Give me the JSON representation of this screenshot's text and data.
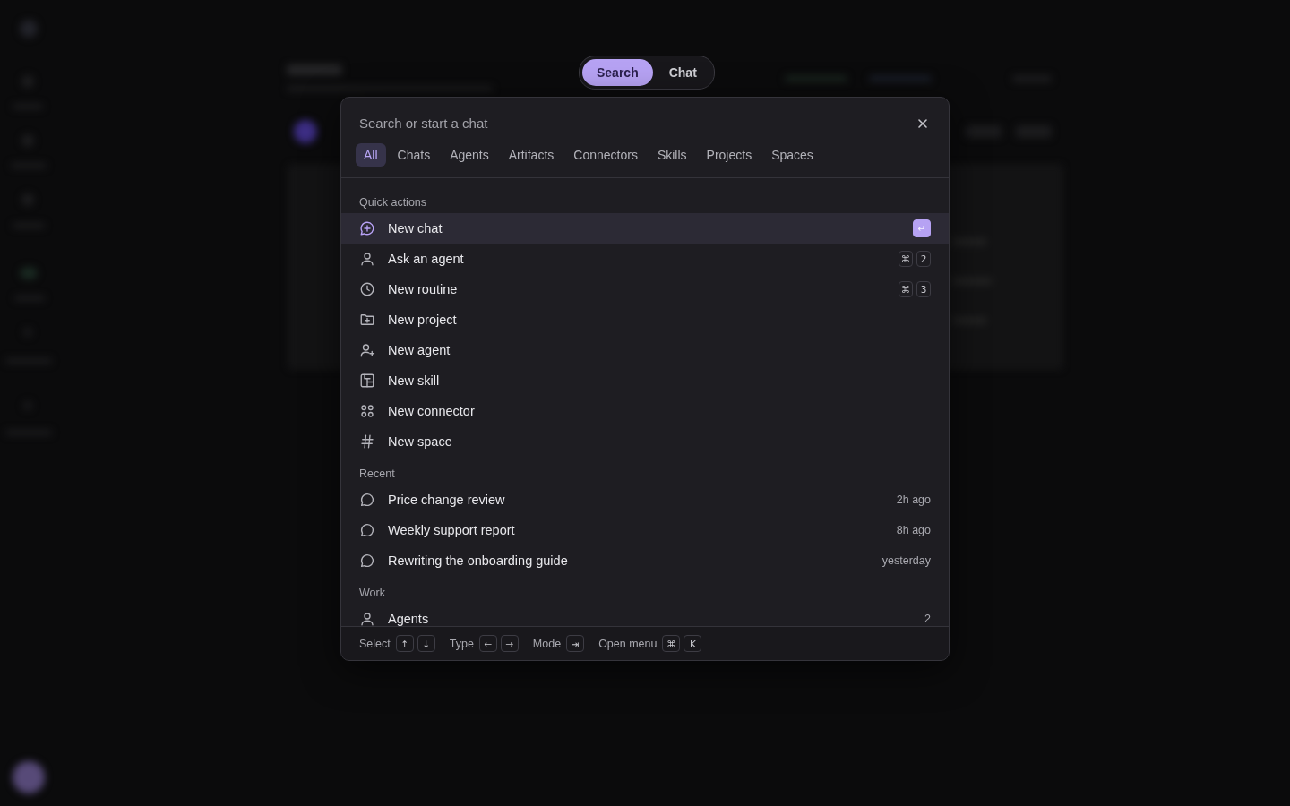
{
  "mode_switch": [
    {
      "label": "Search",
      "selected": true
    },
    {
      "label": "Chat",
      "selected": false
    }
  ],
  "search": {
    "placeholder": "Search or start a chat"
  },
  "filters": [
    {
      "label": "All",
      "selected": true
    },
    {
      "label": "Chats",
      "selected": false
    },
    {
      "label": "Agents",
      "selected": false
    },
    {
      "label": "Artifacts",
      "selected": false
    },
    {
      "label": "Connectors",
      "selected": false
    },
    {
      "label": "Skills",
      "selected": false
    },
    {
      "label": "Projects",
      "selected": false
    },
    {
      "label": "Spaces",
      "selected": false
    }
  ],
  "sections": [
    {
      "title": "Quick actions",
      "items": [
        {
          "label": "New chat",
          "kind": "compose",
          "selected": true,
          "keys": [
            "↵"
          ]
        },
        {
          "label": "Ask an agent",
          "kind": "person",
          "selected": false,
          "keys": [
            "⌘",
            "2"
          ]
        },
        {
          "label": "New routine",
          "kind": "routine",
          "selected": false,
          "keys": [
            "⌘",
            "3"
          ]
        },
        {
          "label": "New project",
          "kind": "project",
          "selected": false
        },
        {
          "label": "New agent",
          "kind": "agent",
          "selected": false
        },
        {
          "label": "New skill",
          "kind": "skill",
          "selected": false
        },
        {
          "label": "New connector",
          "kind": "connector",
          "selected": false
        },
        {
          "label": "New space",
          "kind": "space",
          "selected": false
        }
      ]
    },
    {
      "title": "Recent",
      "items": [
        {
          "label": "Price change review",
          "kind": "conversation",
          "selected": false,
          "meta": "2h ago"
        },
        {
          "label": "Weekly support report",
          "kind": "conversation",
          "selected": false,
          "meta": "8h ago"
        },
        {
          "label": "Rewriting the onboarding guide",
          "kind": "conversation",
          "selected": false,
          "meta": "yesterday"
        }
      ]
    },
    {
      "title": "Work",
      "items": [
        {
          "label": "Agents",
          "kind": "person",
          "selected": false,
          "meta": "2"
        }
      ]
    }
  ],
  "footer": [
    {
      "label": "Select",
      "keys": [
        "↑",
        "↓"
      ]
    },
    {
      "label": "Type",
      "keys": [
        "←",
        "→"
      ]
    },
    {
      "label": "Mode",
      "keys": [
        "⇥"
      ]
    },
    {
      "label": "Open menu",
      "keys": [
        "⌘",
        "K"
      ]
    }
  ]
}
